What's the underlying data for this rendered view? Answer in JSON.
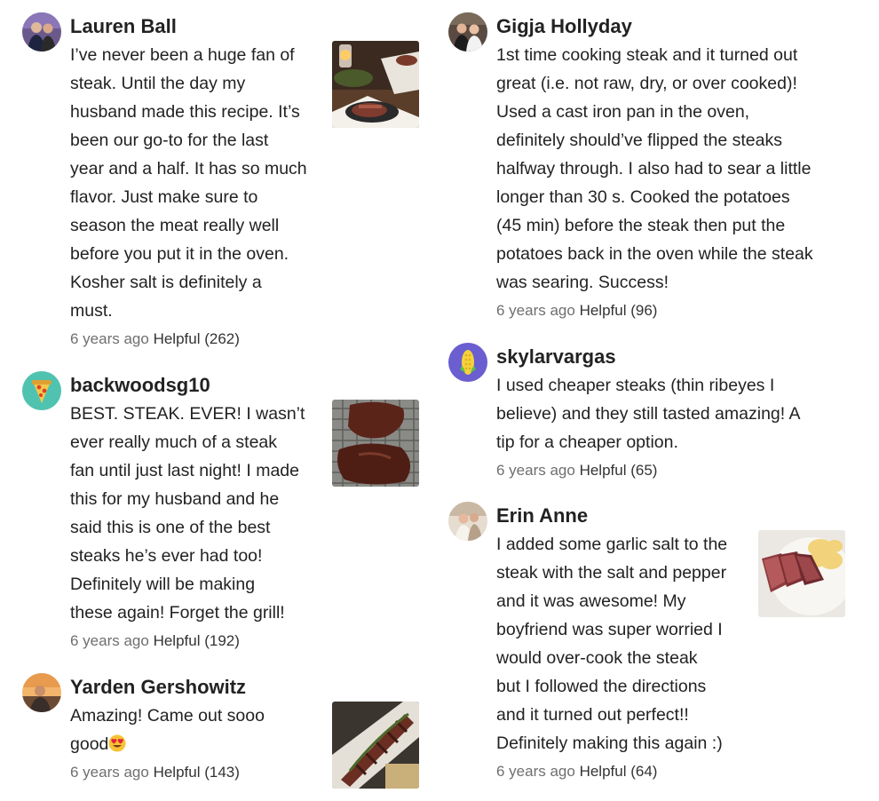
{
  "comments": [
    {
      "user": "Lauren Ball",
      "lines": [
        "I’ve never been a huge fan of",
        "steak. Until the day my",
        "husband made this recipe. It’s",
        "been our go-to for the last",
        "year and a half. It has so much",
        "flavor. Just make sure to",
        "season the meat really well",
        "before you put it in the oven.",
        "Kosher salt is definitely a",
        "must."
      ],
      "age": "6 years ago",
      "helpful": "Helpful (262)"
    },
    {
      "user": "backwoodsg10",
      "lines": [
        "BEST. STEAK. EVER! I wasn’t",
        "ever really much of a steak",
        "fan until just last night! I made",
        "this for my husband and he",
        "said this is one of the best",
        "steaks he’s ever had too!",
        "Definitely will be making",
        "these again! Forget the grill!"
      ],
      "age": "6 years ago",
      "helpful": "Helpful (192)"
    },
    {
      "user": "Yarden Gershowitz",
      "lines": [
        "Amazing! Came out sooo",
        "good"
      ],
      "emoji": "heart-eyes-emoji",
      "age": "6 years ago",
      "helpful": "Helpful (143)"
    },
    {
      "user": "Gigja Hollyday",
      "lines": [
        "1st time cooking steak and it turned out",
        "great (i.e. not raw, dry, or over cooked)!",
        "Used a cast iron pan in the oven,",
        "definitely should’ve flipped the steaks",
        "halfway through. I also had to sear a little",
        "longer than 30 s. Cooked the potatoes",
        "(45 min) before the steak then put the",
        "potatoes back in the oven while the steak",
        "was searing. Success!"
      ],
      "age": "6 years ago",
      "helpful": "Helpful (96)"
    },
    {
      "user": "skylarvargas",
      "lines": [
        "I used cheaper steaks (thin ribeyes I",
        "believe) and they still tasted amazing! A",
        "tip for a cheaper option."
      ],
      "age": "6 years ago",
      "helpful": "Helpful (65)"
    },
    {
      "user": "Erin Anne",
      "lines": [
        "I added some garlic salt to the",
        "steak with the salt and pepper",
        "and it was awesome! My",
        "boyfriend was super worried I",
        "would over-cook the steak",
        "but I followed the directions",
        "and it turned out perfect!!",
        "Definitely making this again :)"
      ],
      "age": "6 years ago",
      "helpful": "Helpful (64)"
    }
  ]
}
